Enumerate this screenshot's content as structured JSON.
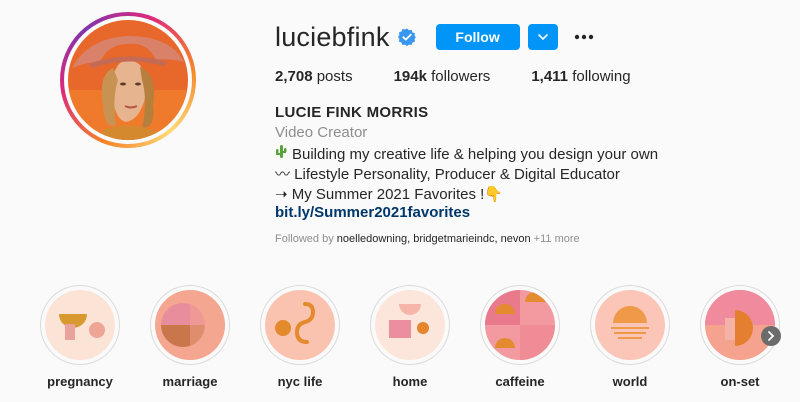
{
  "profile": {
    "username": "luciebfink",
    "verified_icon": "verified-badge-icon",
    "follow_label": "Follow",
    "dropdown_icon": "chevron-down-icon",
    "more_icon": "more-options-icon"
  },
  "stats": {
    "posts_count": "2,708",
    "posts_label": " posts",
    "followers_count": "194k",
    "followers_label": " followers",
    "following_count": "1,411",
    "following_label": " following"
  },
  "bio": {
    "full_name": "LUCIE FINK MORRIS",
    "category": "Video Creator",
    "line1": "Building my creative life & helping you design your own",
    "line2": "〰 Lifestyle Personality, Producer & Digital Educator",
    "line3": "➝ My Summer 2021 Favorites !👇",
    "link": "bit.ly/Summer2021favorites",
    "followed_by_prefix": "Followed by ",
    "followed_by_names": "noelledowning, bridgetmarieindc, nevon",
    "followed_by_suffix": " +11 more"
  },
  "highlights": [
    {
      "label": "pregnancy"
    },
    {
      "label": "marriage"
    },
    {
      "label": "nyc life"
    },
    {
      "label": "home"
    },
    {
      "label": "caffeine"
    },
    {
      "label": "world"
    },
    {
      "label": "on-set"
    }
  ],
  "colors": {
    "accent": "#0095f6",
    "link": "#00376b",
    "muted": "#8e8e8e",
    "background": "#fafafa"
  }
}
